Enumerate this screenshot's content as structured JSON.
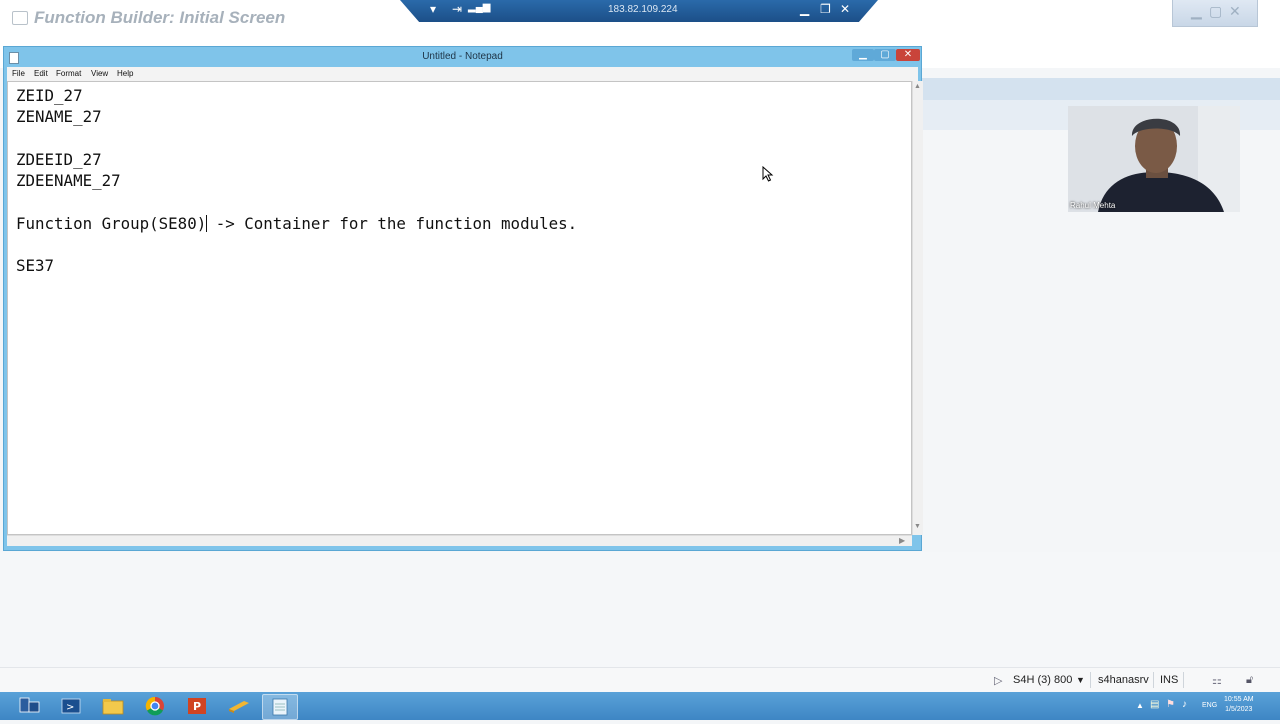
{
  "sap": {
    "screen_title": "Function Builder: Initial Screen",
    "status": {
      "system": "S4H (3) 800",
      "server": "s4hanasrv",
      "mode": "INS"
    }
  },
  "remote_desktop": {
    "address": "183.82.109.224"
  },
  "notepad": {
    "title": "Untitled - Notepad",
    "menu": [
      "File",
      "Edit",
      "Format",
      "View",
      "Help"
    ],
    "content_before_caret": "ZEID_27\nZENAME_27\n\nZDEEID_27\nZDEENAME_27\n\nFunction Group(SE80)",
    "content_after_caret": " -> Container for the function modules.\n\nSE37"
  },
  "webcam": {
    "participant_name": "Rahul Mehta"
  },
  "taskbar": {
    "tray_language": "ENG",
    "time": "10:55 AM",
    "date": "1/5/2023",
    "apps": [
      "server-manager-icon",
      "powershell-icon",
      "file-explorer-icon",
      "chrome-icon",
      "powerpoint-icon",
      "sap-logon-icon",
      "notepad-icon"
    ]
  }
}
